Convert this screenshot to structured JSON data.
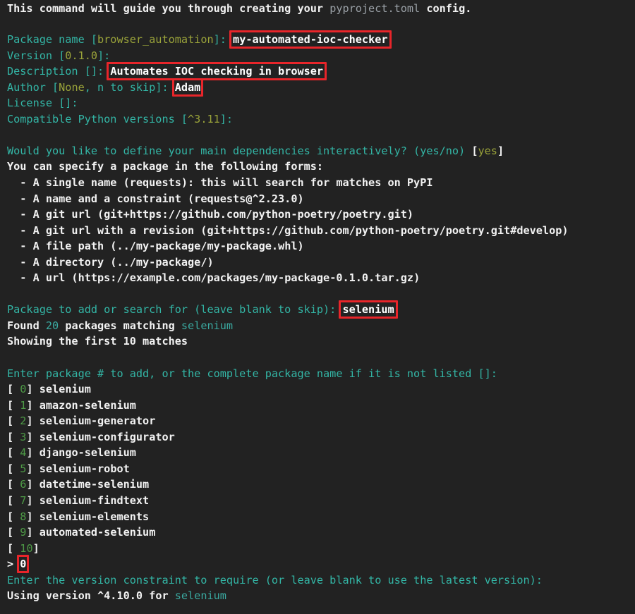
{
  "terminal": {
    "theme": {
      "background": "#222222",
      "default_text": "#e9e9e9",
      "prompt_label": "#33b6a6",
      "default_value": "#9aa33a",
      "index_number": "#4e9a46",
      "highlight_border": "#e8252a",
      "muted": "#9aa0a6"
    },
    "intro": {
      "text_a": "This command will guide you through creating your ",
      "file": "pyproject.toml",
      "text_b": " config."
    },
    "prompts": {
      "package_name": {
        "label": "Package name [",
        "default": "browser_automation",
        "label_end": "]: ",
        "value": "my-automated-ioc-checker"
      },
      "version": {
        "label": "Version [",
        "default": "0.1.0",
        "label_end": "]:"
      },
      "description": {
        "label": "Description []: ",
        "value": "Automates IOC checking in browser"
      },
      "author": {
        "label_a": "Author [",
        "default": "None",
        "label_b": ", n to skip]: ",
        "value": "Adam"
      },
      "license": {
        "label": "License []:"
      },
      "python_versions": {
        "label": "Compatible Python versions [",
        "default": "^3.11",
        "label_end": "]:"
      }
    },
    "dependencies_prompt": {
      "question": "Would you like to define your main dependencies interactively? (yes/no) ",
      "bracket_open": "[",
      "default": "yes",
      "bracket_close": "]"
    },
    "forms_header": "You can specify a package in the following forms:",
    "forms": [
      {
        "prefix": "  - A single name (",
        "code": "requests",
        "suffix": "): this will search for matches on PyPI"
      },
      {
        "prefix": "  - A name and a constraint (",
        "code": "requests@^2.23.0",
        "suffix": ")"
      },
      {
        "prefix": "  - A git url (",
        "code": "git+https://github.com/python-poetry/poetry.git",
        "suffix": ")"
      },
      {
        "prefix": "  - A git url with a revision (",
        "code": "git+https://github.com/python-poetry/poetry.git#develop",
        "suffix": ")"
      },
      {
        "prefix": "  - A file path (",
        "code": "../my-package/my-package.whl",
        "suffix": ")"
      },
      {
        "prefix": "  - A directory (",
        "code": "../my-package/",
        "suffix": ")"
      },
      {
        "prefix": "  - A url (",
        "code": "https://example.com/packages/my-package-0.1.0.tar.gz",
        "suffix": ")"
      }
    ],
    "search_prompt": {
      "label": "Package to add or search for (leave blank to skip): ",
      "value": "selenium"
    },
    "search_result": {
      "found_prefix": "Found ",
      "count": "20",
      "found_mid": " packages matching ",
      "query": "selenium",
      "showing": "Showing the first 10 matches"
    },
    "package_pick_prompt": "Enter package # to add, or the complete package name if it is not listed []:",
    "packages": [
      {
        "index": "0",
        "name": "selenium"
      },
      {
        "index": "1",
        "name": "amazon-selenium"
      },
      {
        "index": "2",
        "name": "selenium-generator"
      },
      {
        "index": "3",
        "name": "selenium-configurator"
      },
      {
        "index": "4",
        "name": "django-selenium"
      },
      {
        "index": "5",
        "name": "selenium-robot"
      },
      {
        "index": "6",
        "name": "datetime-selenium"
      },
      {
        "index": "7",
        "name": "selenium-findtext"
      },
      {
        "index": "8",
        "name": "selenium-elements"
      },
      {
        "index": "9",
        "name": "automated-selenium"
      },
      {
        "index": "10",
        "name": ""
      }
    ],
    "user_selection": {
      "prompt_char": "> ",
      "value": "0"
    },
    "version_prompt": "Enter the version constraint to require (or leave blank to use the latest version):",
    "using_version": {
      "prefix": "Using version ",
      "version": "^4.10.0",
      "mid": " for ",
      "package": "selenium"
    }
  }
}
